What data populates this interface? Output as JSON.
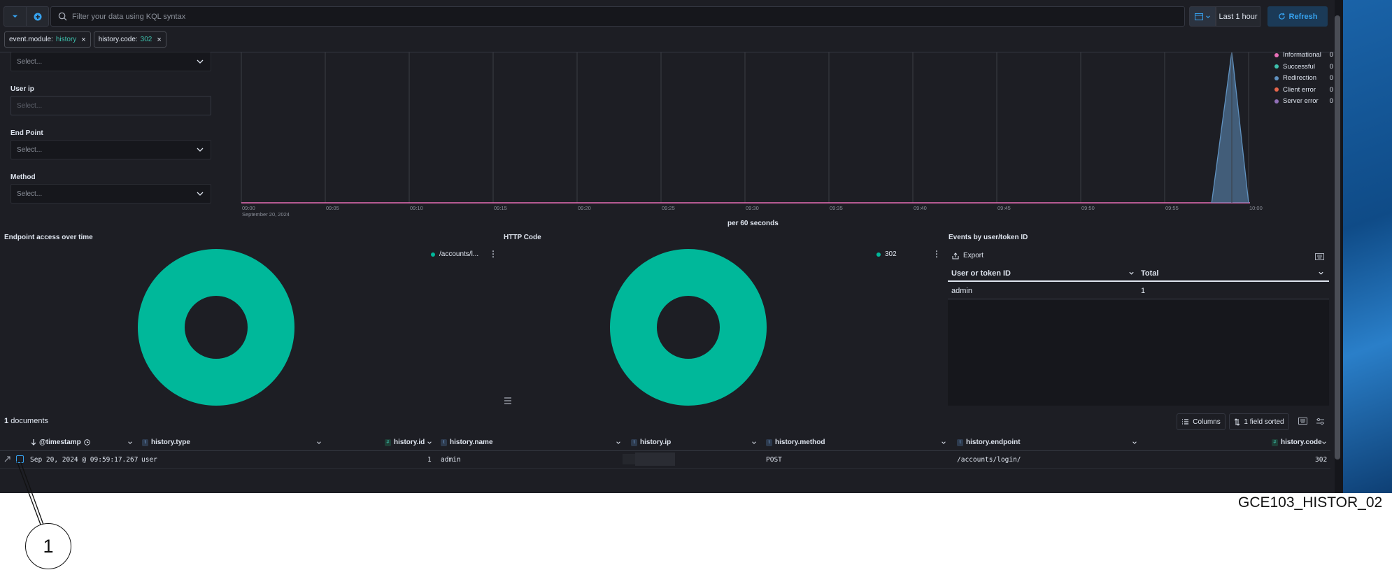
{
  "toolbar": {
    "search_placeholder": "Filter your data using KQL syntax",
    "time_range": "Last 1 hour",
    "refresh_label": "Refresh"
  },
  "filters": [
    {
      "field": "event.module:",
      "value": "history"
    },
    {
      "field": "history.code:",
      "value": "302"
    }
  ],
  "controls": {
    "top_select_placeholder": "Select...",
    "user_ip_label": "User ip",
    "user_ip_placeholder": "Select...",
    "endpoint_label": "End Point",
    "endpoint_placeholder": "Select...",
    "method_label": "Method",
    "method_placeholder": "Select..."
  },
  "timeline": {
    "interval_label": "per 60 seconds",
    "date_label": "September 20, 2024",
    "legend": [
      {
        "label": "Informational",
        "count": "0",
        "color": "#e86fb7"
      },
      {
        "label": "Successful",
        "count": "0",
        "color": "#3ec1ad"
      },
      {
        "label": "Redirection",
        "count": "0",
        "color": "#6092c0"
      },
      {
        "label": "Client error",
        "count": "0",
        "color": "#e7664c"
      },
      {
        "label": "Server error",
        "count": "0",
        "color": "#9170b8"
      }
    ]
  },
  "chart_data": [
    {
      "type": "area",
      "x": [
        "09:00",
        "09:05",
        "09:10",
        "09:15",
        "09:20",
        "09:25",
        "09:30",
        "09:35",
        "09:40",
        "09:45",
        "09:50",
        "09:55",
        "10:00"
      ],
      "ylim": [
        0,
        1
      ],
      "yticks": [
        "0",
        "0.2",
        "0.4",
        "0.6",
        "0.8"
      ],
      "xlabel": "per 60 seconds",
      "series": [
        {
          "name": "Redirection",
          "peak_at": "09:59",
          "peak_value": 1,
          "color": "#6092c0"
        }
      ]
    },
    {
      "type": "pie",
      "title": "Endpoint access over time",
      "categories": [
        "/accounts/l..."
      ],
      "values": [
        1
      ]
    },
    {
      "type": "pie",
      "title": "HTTP Code",
      "categories": [
        "302"
      ],
      "values": [
        1
      ]
    }
  ],
  "panels": {
    "endpoint_title": "Endpoint access over time",
    "endpoint_legend": "/accounts/l...",
    "http_title": "HTTP Code",
    "http_legend": "302",
    "events_title": "Events by user/token ID",
    "export_label": "Export",
    "user_columns": [
      "User or token ID",
      "Total"
    ],
    "user_rows": [
      [
        "admin",
        "1"
      ]
    ],
    "donut_color": "#00b89a"
  },
  "documents": {
    "count": "1",
    "count_label": "documents",
    "columns_label": "Columns",
    "sort_label": "1 field sorted",
    "headers": [
      "@timestamp",
      "history.type",
      "history.id",
      "history.name",
      "history.ip",
      "history.method",
      "history.endpoint",
      "history.code"
    ],
    "row": {
      "timestamp": "Sep 20, 2024 @ 09:59:17.267",
      "type": "user",
      "id": "1",
      "name": "admin",
      "method": "POST",
      "endpoint": "/accounts/login/",
      "code": "302"
    }
  },
  "annotation": {
    "caption": "GCE103_HISTOR_02",
    "callout_number": "1"
  }
}
